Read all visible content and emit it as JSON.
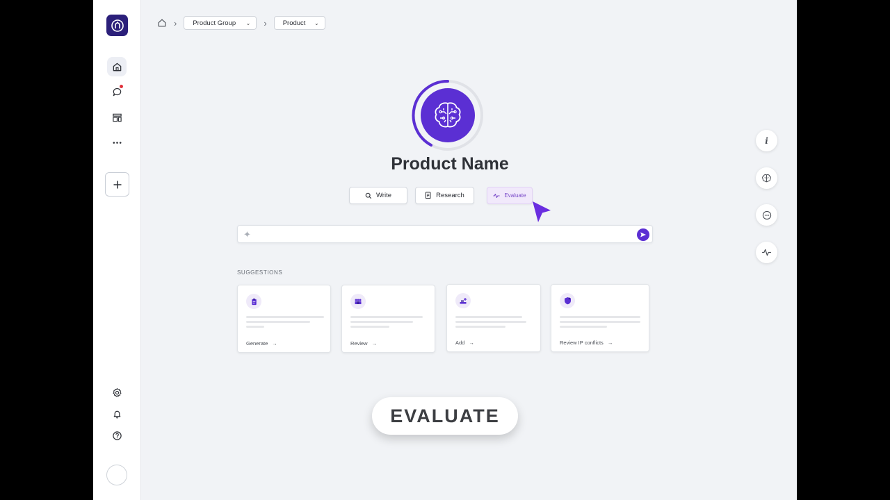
{
  "breadcrumb": {
    "group_label": "Product Group",
    "product_label": "Product"
  },
  "hero": {
    "title": "Product Name"
  },
  "modes": {
    "write": "Write",
    "research": "Research",
    "evaluate": "Evaluate"
  },
  "prompt": {
    "placeholder": ""
  },
  "suggestions": {
    "title": "SUGGESTIONS",
    "cards": [
      {
        "link": "Generate",
        "icon": "clipboard-icon"
      },
      {
        "link": "Review",
        "icon": "team-icon"
      },
      {
        "link": "Add",
        "icon": "stack-add-icon"
      },
      {
        "link": "Review IP conflicts",
        "icon": "shield-icon"
      }
    ]
  },
  "overlay": {
    "caption": "EVALUATE"
  },
  "sidebar": {
    "notification_badge": true
  },
  "colors": {
    "accent": "#5b2fd3",
    "logo": "#2b1f7a",
    "background": "#f1f3f6"
  }
}
